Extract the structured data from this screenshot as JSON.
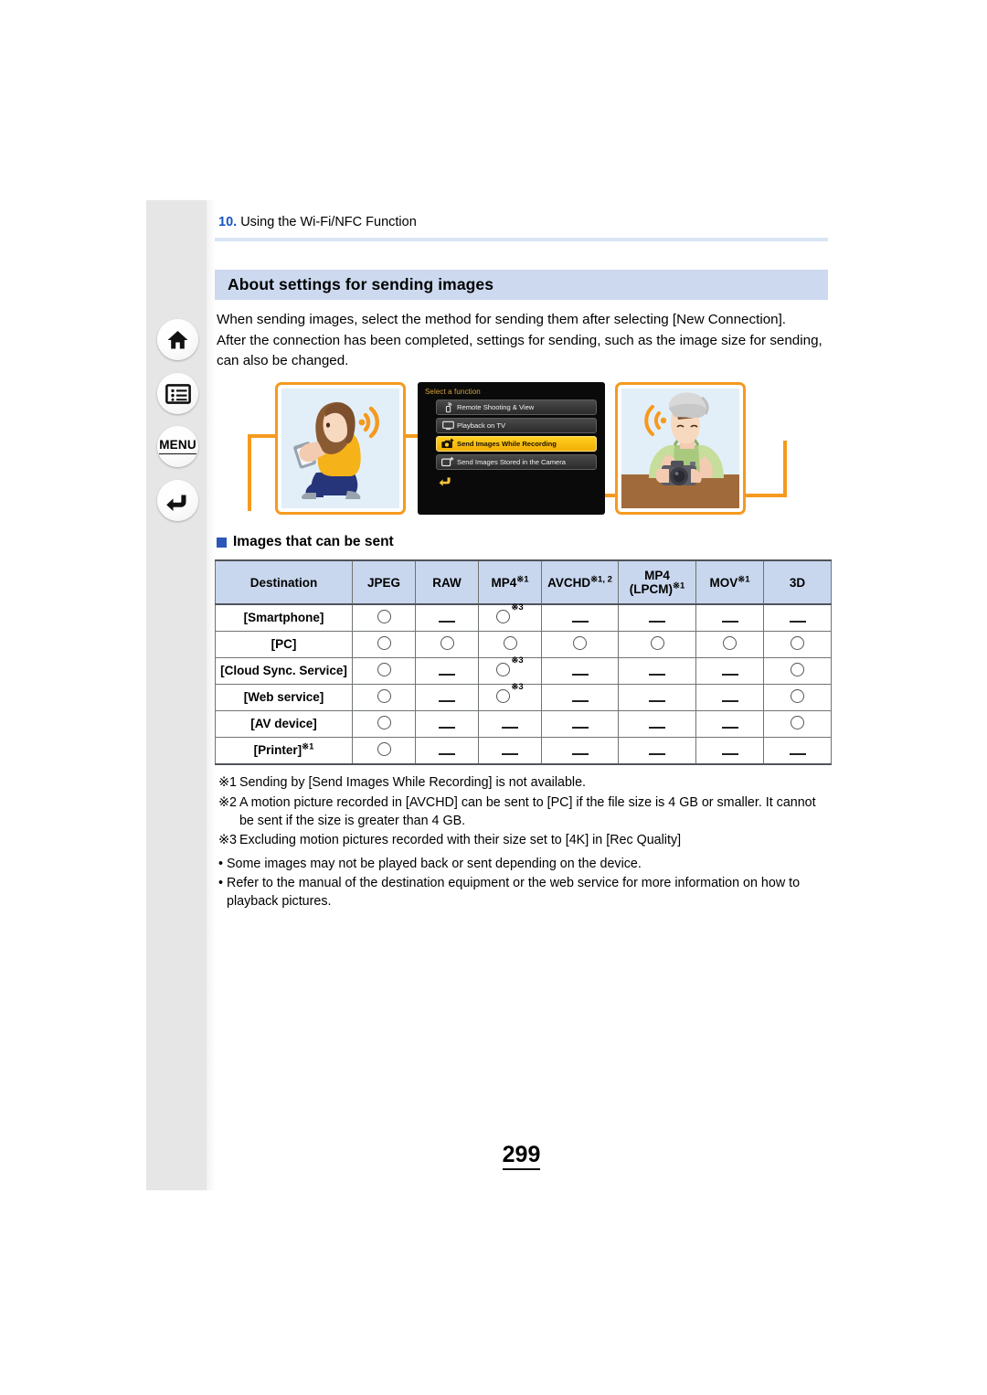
{
  "sidebar": {
    "items": [
      {
        "name": "home",
        "icon": "home-icon",
        "label": ""
      },
      {
        "name": "contents",
        "icon": "contents-list-icon",
        "label": ""
      },
      {
        "name": "menu",
        "icon": "menu-text",
        "label": "MENU"
      },
      {
        "name": "back",
        "icon": "back-arrow-icon",
        "label": ""
      }
    ]
  },
  "chapter": {
    "number": "10.",
    "title": "Using the Wi-Fi/NFC Function"
  },
  "section": {
    "title": "About settings for sending images"
  },
  "intro": {
    "paragraph1": "When sending images, select the method for sending them after selecting [New Connection].",
    "paragraph2": "After the connection has been completed, settings for sending, such as the image size for sending, can also be changed."
  },
  "figure": {
    "left_illustration": "woman-kneeling-with-smartphone-illustration",
    "right_illustration": "person-with-camera-illustration",
    "lcd": {
      "title": "Select a function",
      "items": [
        {
          "label": "Remote Shooting & View",
          "icon": "remote-shooting-icon",
          "highlighted": false
        },
        {
          "label": "Playback on TV",
          "icon": "playback-tv-icon",
          "highlighted": false
        },
        {
          "label": "Send Images While Recording",
          "icon": "send-while-recording-icon",
          "highlighted": true
        },
        {
          "label": "Send Images Stored in the Camera",
          "icon": "send-stored-icon",
          "highlighted": false
        }
      ],
      "back_icon": "lcd-back-arrow-icon"
    }
  },
  "subheading": {
    "text": "Images that can be sent"
  },
  "table": {
    "headers": [
      {
        "label": "Destination",
        "sup": ""
      },
      {
        "label": "JPEG",
        "sup": ""
      },
      {
        "label": "RAW",
        "sup": ""
      },
      {
        "label": "MP4",
        "sup": "※1"
      },
      {
        "label": "AVCHD",
        "sup": "※1, 2"
      },
      {
        "label": "MP4 (LPCM)",
        "sup": "※1"
      },
      {
        "label": "MOV",
        "sup": "※1"
      },
      {
        "label": "3D",
        "sup": ""
      }
    ],
    "rows": [
      {
        "destination": "[Smartphone]",
        "destination_sup": "",
        "cells": [
          {
            "mark": "circle",
            "sup": ""
          },
          {
            "mark": "dash",
            "sup": ""
          },
          {
            "mark": "circle",
            "sup": "※3"
          },
          {
            "mark": "dash",
            "sup": ""
          },
          {
            "mark": "dash",
            "sup": ""
          },
          {
            "mark": "dash",
            "sup": ""
          },
          {
            "mark": "dash",
            "sup": ""
          }
        ]
      },
      {
        "destination": "[PC]",
        "destination_sup": "",
        "cells": [
          {
            "mark": "circle",
            "sup": ""
          },
          {
            "mark": "circle",
            "sup": ""
          },
          {
            "mark": "circle",
            "sup": ""
          },
          {
            "mark": "circle",
            "sup": ""
          },
          {
            "mark": "circle",
            "sup": ""
          },
          {
            "mark": "circle",
            "sup": ""
          },
          {
            "mark": "circle",
            "sup": ""
          }
        ]
      },
      {
        "destination": "[Cloud Sync. Service]",
        "destination_sup": "",
        "cells": [
          {
            "mark": "circle",
            "sup": ""
          },
          {
            "mark": "dash",
            "sup": ""
          },
          {
            "mark": "circle",
            "sup": "※3"
          },
          {
            "mark": "dash",
            "sup": ""
          },
          {
            "mark": "dash",
            "sup": ""
          },
          {
            "mark": "dash",
            "sup": ""
          },
          {
            "mark": "circle",
            "sup": ""
          }
        ]
      },
      {
        "destination": "[Web service]",
        "destination_sup": "",
        "cells": [
          {
            "mark": "circle",
            "sup": ""
          },
          {
            "mark": "dash",
            "sup": ""
          },
          {
            "mark": "circle",
            "sup": "※3"
          },
          {
            "mark": "dash",
            "sup": ""
          },
          {
            "mark": "dash",
            "sup": ""
          },
          {
            "mark": "dash",
            "sup": ""
          },
          {
            "mark": "circle",
            "sup": ""
          }
        ]
      },
      {
        "destination": "[AV device]",
        "destination_sup": "",
        "cells": [
          {
            "mark": "circle",
            "sup": ""
          },
          {
            "mark": "dash",
            "sup": ""
          },
          {
            "mark": "dash",
            "sup": ""
          },
          {
            "mark": "dash",
            "sup": ""
          },
          {
            "mark": "dash",
            "sup": ""
          },
          {
            "mark": "dash",
            "sup": ""
          },
          {
            "mark": "circle",
            "sup": ""
          }
        ]
      },
      {
        "destination": "[Printer]",
        "destination_sup": "※1",
        "cells": [
          {
            "mark": "circle",
            "sup": ""
          },
          {
            "mark": "dash",
            "sup": ""
          },
          {
            "mark": "dash",
            "sup": ""
          },
          {
            "mark": "dash",
            "sup": ""
          },
          {
            "mark": "dash",
            "sup": ""
          },
          {
            "mark": "dash",
            "sup": ""
          },
          {
            "mark": "dash",
            "sup": ""
          }
        ]
      }
    ]
  },
  "footnotes": [
    {
      "mark": "※1",
      "text": "Sending by [Send Images While Recording] is not available."
    },
    {
      "mark": "※2",
      "text": "A motion picture recorded in [AVCHD] can be sent to [PC] if the file size is 4 GB or smaller. It cannot be sent if the size is greater than 4 GB."
    },
    {
      "mark": "※3",
      "text": "Excluding motion pictures recorded with their size set to [4K] in [Rec Quality]"
    }
  ],
  "notes": [
    {
      "bullet": "•",
      "text": "Some images may not be played back or sent depending on the device."
    },
    {
      "bullet": "•",
      "text": "Refer to the manual of the destination equipment or the web service for more information on how to playback pictures."
    }
  ],
  "page_number": "299",
  "colors": {
    "accent_blue": "#1554c6",
    "banner_blue": "#ccd9ef",
    "table_header_blue": "#c8d7ee",
    "marker_blue": "#2c56b8",
    "frame_orange": "#f59a1e",
    "lcd_highlight": "#ffd01f"
  }
}
